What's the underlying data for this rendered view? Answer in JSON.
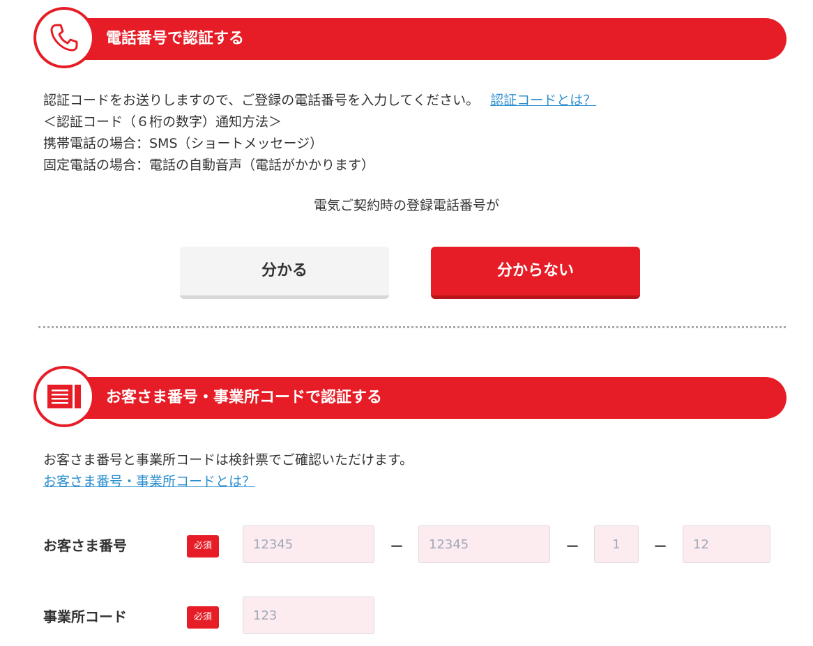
{
  "phone_section": {
    "title": "電話番号で認証する",
    "icon": "phone-icon",
    "description_line1": "認証コードをお送りしますので、ご登録の電話番号を入力してください。",
    "help_link": "認証コードとは？",
    "method_heading": "＜認証コード（６桁の数字）通知方法＞",
    "mobile_line": "携帯電話の場合：SMS（ショートメッセージ）",
    "landline_line": "固定電話の場合：電話の自動音声（電話がかかります）",
    "question": "電気ご契約時の登録電話番号が",
    "know_button": "分かる",
    "dont_know_button": "分からない"
  },
  "customer_section": {
    "title": "お客さま番号・事業所コードで認証する",
    "icon": "meter-slip-icon",
    "description": "お客さま番号と事業所コードは検針票でご確認いただけます。",
    "help_link": "お客さま番号・事業所コードとは？",
    "customer_number": {
      "label": "お客さま番号",
      "required_badge": "必須",
      "separator": "－",
      "fields": [
        {
          "placeholder": "12345",
          "value": ""
        },
        {
          "placeholder": "12345",
          "value": ""
        },
        {
          "placeholder": "1",
          "value": ""
        },
        {
          "placeholder": "12",
          "value": ""
        }
      ]
    },
    "office_code": {
      "label": "事業所コード",
      "required_badge": "必須",
      "placeholder": "123",
      "value": ""
    }
  },
  "colors": {
    "brand_red": "#e61d26",
    "link_blue": "#2c8fd0",
    "input_bg": "#fdecef"
  }
}
